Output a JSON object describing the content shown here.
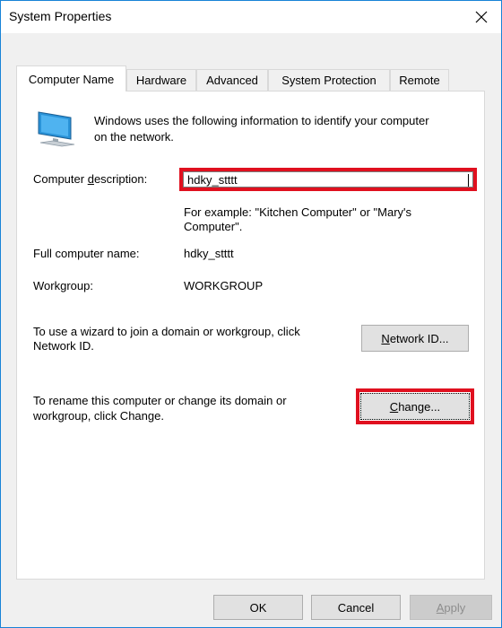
{
  "window": {
    "title": "System Properties",
    "close_label": "×"
  },
  "tabs": [
    {
      "label": "Computer Name"
    },
    {
      "label": "Hardware"
    },
    {
      "label": "Advanced"
    },
    {
      "label": "System Protection"
    },
    {
      "label": "Remote"
    }
  ],
  "panel": {
    "intro_line1": "Windows uses the following information to identify your computer",
    "intro_line2": "on the network.",
    "description_label_pre": "Computer ",
    "description_label_u": "d",
    "description_label_post": "escription:",
    "description_value": "hdky_stttt",
    "example_line1": "For example: \"Kitchen Computer\" or \"Mary's",
    "example_line2": "Computer\".",
    "full_name_label": "Full computer name:",
    "full_name_value": "hdky_stttt",
    "workgroup_label": "Workgroup:",
    "workgroup_value": "WORKGROUP",
    "join_line1": "To use a wizard to join a domain or workgroup, click",
    "join_line2": "Network ID.",
    "network_id_u": "N",
    "network_id_rest": "etwork ID...",
    "rename_line1": "To rename this computer or change its domain or",
    "rename_line2": "workgroup, click Change.",
    "change_u": "C",
    "change_rest": "hange..."
  },
  "footer": {
    "ok_label": "OK",
    "cancel_label": "Cancel",
    "apply_u": "A",
    "apply_rest": "pply"
  },
  "colors": {
    "highlight": "#e0101f",
    "window_border": "#1883d7"
  }
}
